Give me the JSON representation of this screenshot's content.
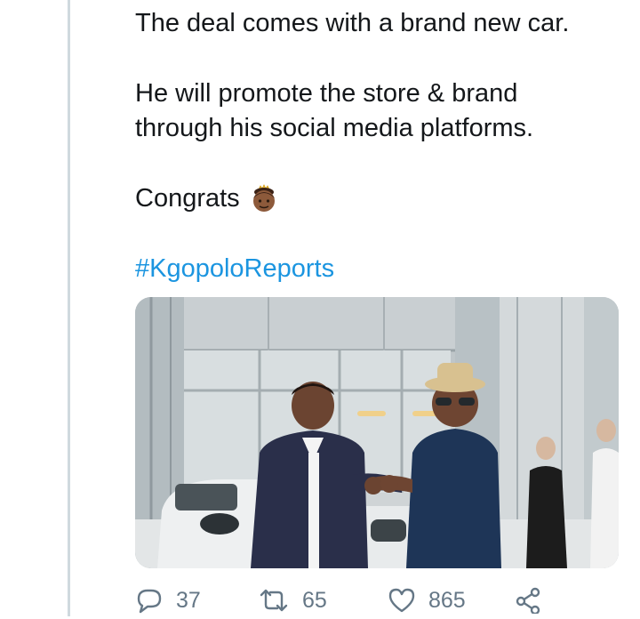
{
  "tweet": {
    "lines": [
      "The deal comes with a brand new car.",
      "He will promote the store & brand",
      "through his social media platforms.",
      "Congrats"
    ],
    "hashtag": "#KgopoloReports"
  },
  "media": {
    "description_icon": "photo"
  },
  "actions": {
    "replies": "37",
    "retweets": "65",
    "likes": "865"
  },
  "colors": {
    "text": "#14171a",
    "link": "#1b95e0",
    "muted": "#657786",
    "thread_line": "#cfd9de"
  }
}
